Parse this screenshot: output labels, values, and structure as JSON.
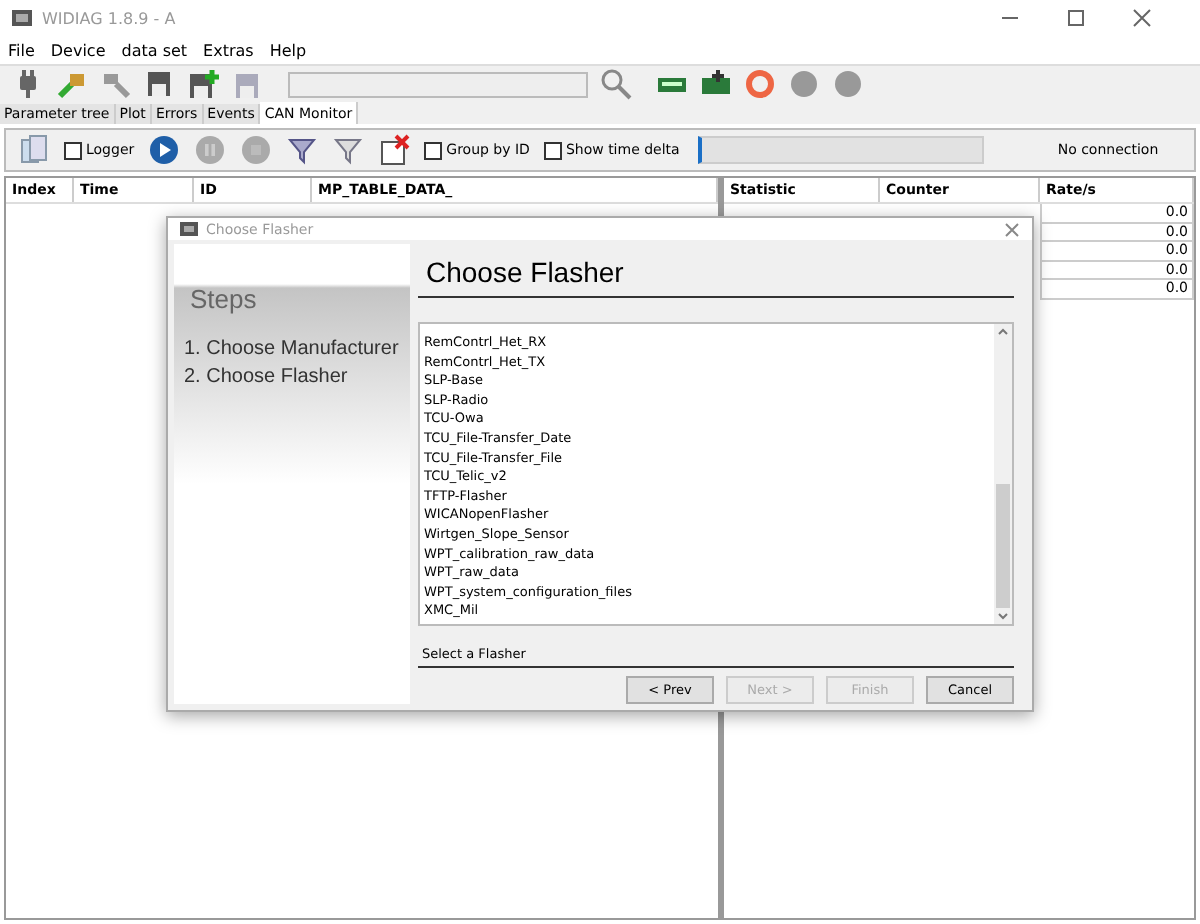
{
  "window": {
    "title": "WIDIAG 1.8.9 - A"
  },
  "menu": [
    "File",
    "Device",
    "data set",
    "Extras",
    "Help"
  ],
  "tabs": [
    {
      "label": "Parameter tree",
      "selected": false
    },
    {
      "label": "Plot",
      "selected": false
    },
    {
      "label": "Errors",
      "selected": false
    },
    {
      "label": "Events",
      "selected": false
    },
    {
      "label": "CAN Monitor",
      "selected": true
    }
  ],
  "can_toolbar": {
    "checkboxes": [
      {
        "label": "Logger",
        "checked": false
      },
      {
        "label": "Group by ID",
        "checked": false
      },
      {
        "label": "Show time delta",
        "checked": false
      }
    ],
    "status": "No connection"
  },
  "table": {
    "columns": [
      "Index",
      "Time",
      "ID",
      "MP_TABLE_DATA_"
    ]
  },
  "statistics": {
    "columns": [
      "Statistic",
      "Counter",
      "Rate/s"
    ],
    "rates": [
      "0.0",
      "0.0",
      "0.0",
      "0.0",
      "0.0"
    ]
  },
  "dialog": {
    "title": "Choose Flasher",
    "steps_title": "Steps",
    "steps": [
      "1. Choose Manufacturer",
      "2. Choose Flasher"
    ],
    "heading": "Choose Flasher",
    "flashers": [
      "RemContrl_Het_RX",
      "RemContrl_Het_TX",
      "SLP-Base",
      "SLP-Radio",
      "TCU-Owa",
      "TCU_File-Transfer_Date",
      "TCU_File-Transfer_File",
      "TCU_Telic_v2",
      "TFTP-Flasher",
      "WICANopenFlasher",
      "Wirtgen_Slope_Sensor",
      "WPT_calibration_raw_data",
      "WPT_raw_data",
      "WPT_system_configuration_files",
      "XMC_Mil"
    ],
    "hint": "Select a Flasher",
    "buttons": [
      {
        "label": "< Prev",
        "disabled": false
      },
      {
        "label": "Next >",
        "disabled": true
      },
      {
        "label": "Finish",
        "disabled": true
      },
      {
        "label": "Cancel",
        "disabled": false
      }
    ]
  }
}
